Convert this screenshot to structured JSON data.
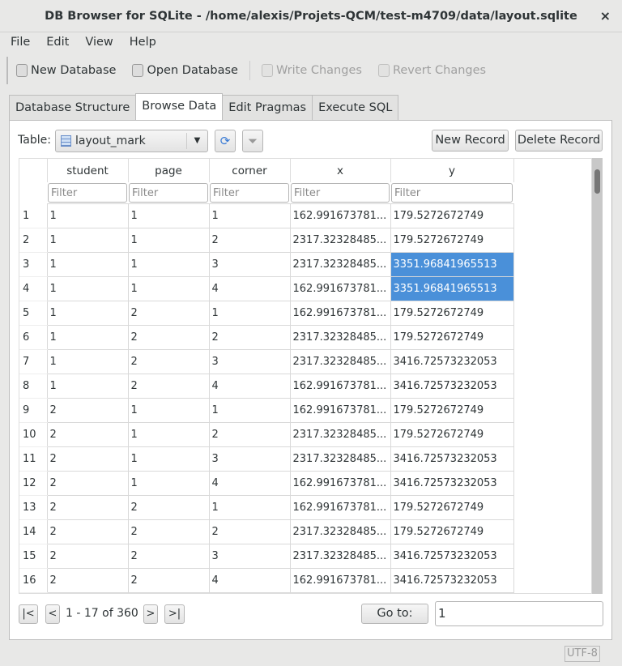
{
  "window": {
    "title": "DB Browser for SQLite - /home/alexis/Projets-QCM/test-m4709/data/layout.sqlite",
    "close": "×"
  },
  "menu": [
    "File",
    "Edit",
    "View",
    "Help"
  ],
  "toolbar": {
    "new_db": "New Database",
    "open_db": "Open Database",
    "write": "Write Changes",
    "revert": "Revert Changes"
  },
  "tabs": [
    "Database Structure",
    "Browse Data",
    "Edit Pragmas",
    "Execute SQL"
  ],
  "browse": {
    "table_label": "Table:",
    "table": "layout_mark",
    "new_record": "New Record",
    "delete_record": "Delete Record"
  },
  "grid": {
    "columns": [
      "student",
      "page",
      "corner",
      "x",
      "y"
    ],
    "filter_placeholder": "Filter",
    "rows": [
      [
        "1",
        "1",
        "1",
        "1",
        "162.991673781...",
        "179.5272672749"
      ],
      [
        "2",
        "1",
        "1",
        "2",
        "2317.32328485...",
        "179.5272672749"
      ],
      [
        "3",
        "1",
        "1",
        "3",
        "2317.32328485...",
        "3351.96841965513"
      ],
      [
        "4",
        "1",
        "1",
        "4",
        "162.991673781...",
        "3351.96841965513"
      ],
      [
        "5",
        "1",
        "2",
        "1",
        "162.991673781...",
        "179.5272672749"
      ],
      [
        "6",
        "1",
        "2",
        "2",
        "2317.32328485...",
        "179.5272672749"
      ],
      [
        "7",
        "1",
        "2",
        "3",
        "2317.32328485...",
        "3416.72573232053"
      ],
      [
        "8",
        "1",
        "2",
        "4",
        "162.991673781...",
        "3416.72573232053"
      ],
      [
        "9",
        "2",
        "1",
        "1",
        "162.991673781...",
        "179.5272672749"
      ],
      [
        "10",
        "2",
        "1",
        "2",
        "2317.32328485...",
        "179.5272672749"
      ],
      [
        "11",
        "2",
        "1",
        "3",
        "2317.32328485...",
        "3416.72573232053"
      ],
      [
        "12",
        "2",
        "1",
        "4",
        "162.991673781...",
        "3416.72573232053"
      ],
      [
        "13",
        "2",
        "2",
        "1",
        "162.991673781...",
        "179.5272672749"
      ],
      [
        "14",
        "2",
        "2",
        "2",
        "2317.32328485...",
        "179.5272672749"
      ],
      [
        "15",
        "2",
        "2",
        "3",
        "2317.32328485...",
        "3416.72573232053"
      ],
      [
        "16",
        "2",
        "2",
        "4",
        "162.991673781...",
        "3416.72573232053"
      ]
    ],
    "selected_rows": [
      2,
      3
    ],
    "selection_color": "#4a90d9"
  },
  "pager": {
    "first": "|<",
    "prev": "<",
    "range": "1 - 17 of 360",
    "next": ">",
    "last": ">|",
    "goto_label": "Go to:",
    "goto_value": "1"
  },
  "status": {
    "encoding": "UTF-8"
  }
}
